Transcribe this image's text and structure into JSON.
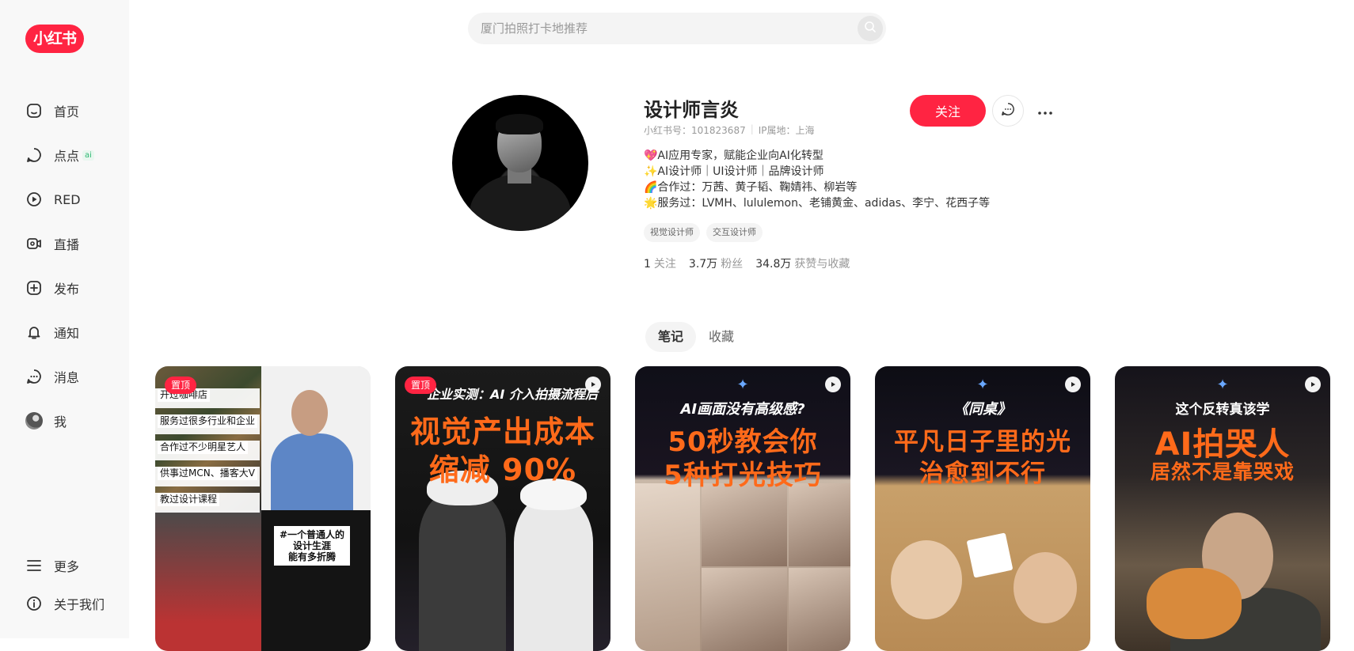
{
  "brand": {
    "logo_text": "小红书",
    "accent": "#ff2442"
  },
  "sidebar": {
    "items": [
      {
        "label": "首页",
        "icon": "home-icon"
      },
      {
        "label": "点点",
        "icon": "chat-bubble-icon",
        "badge": "ai"
      },
      {
        "label": "RED",
        "icon": "play-circle-icon"
      },
      {
        "label": "直播",
        "icon": "live-camera-icon"
      },
      {
        "label": "发布",
        "icon": "plus-square-icon"
      },
      {
        "label": "通知",
        "icon": "bell-icon"
      },
      {
        "label": "消息",
        "icon": "message-icon"
      },
      {
        "label": "我",
        "icon": "avatar-icon"
      }
    ],
    "bottom": [
      {
        "label": "更多",
        "icon": "menu-icon"
      },
      {
        "label": "关于我们",
        "icon": "info-icon"
      }
    ]
  },
  "search": {
    "placeholder": "厦门拍照打卡地推荐",
    "icon": "search-icon"
  },
  "profile": {
    "nickname": "设计师言炎",
    "red_id": "小红书号：101823687",
    "ip": "IP属地：上海",
    "follow_label": "关注",
    "bio": [
      "💖AI应用专家，赋能企业向AI化转型",
      "✨AI设计师｜UI设计师｜品牌设计师",
      "🌈合作过：万茜、黄子韬、鞠婧祎、柳岩等",
      "🌟服务过：LVMH、lululemon、老铺黄金、adidas、李宁、花西子等"
    ],
    "tags": [
      "视觉设计师",
      "交互设计师"
    ],
    "stats": [
      {
        "num": "1",
        "label": "关注"
      },
      {
        "num": "3.7万",
        "label": "粉丝"
      },
      {
        "num": "34.8万",
        "label": "获赞与收藏"
      }
    ]
  },
  "tabs": [
    {
      "label": "笔记",
      "active": true
    },
    {
      "label": "收藏",
      "active": false
    }
  ],
  "notes": [
    {
      "pinned": "置顶",
      "lines": [
        "开过咖啡店",
        "服务过很多行业和企业",
        "合作过不少明星艺人",
        "供事过MCN、播客大V",
        "教过设计课程"
      ],
      "caption": [
        "#一个普通人的",
        "设计生涯",
        "能有多折腾"
      ]
    },
    {
      "pinned": "置顶",
      "video": true,
      "line1": "企业实测：AI 介入拍摄流程后",
      "line2a": "视觉产出成本",
      "line2b": "缩减 90%"
    },
    {
      "video": true,
      "line1": "AI画面没有高级感?",
      "line2a": "50秒教会你",
      "line2b": "5种打光技巧"
    },
    {
      "video": true,
      "line1": "《同桌》",
      "line2a": "平凡日子里的光",
      "line2b": "治愈到不行"
    },
    {
      "video": true,
      "line1": "这个反转真该学",
      "line2a": "AI拍哭人",
      "line2b": "居然不是靠哭戏"
    }
  ]
}
